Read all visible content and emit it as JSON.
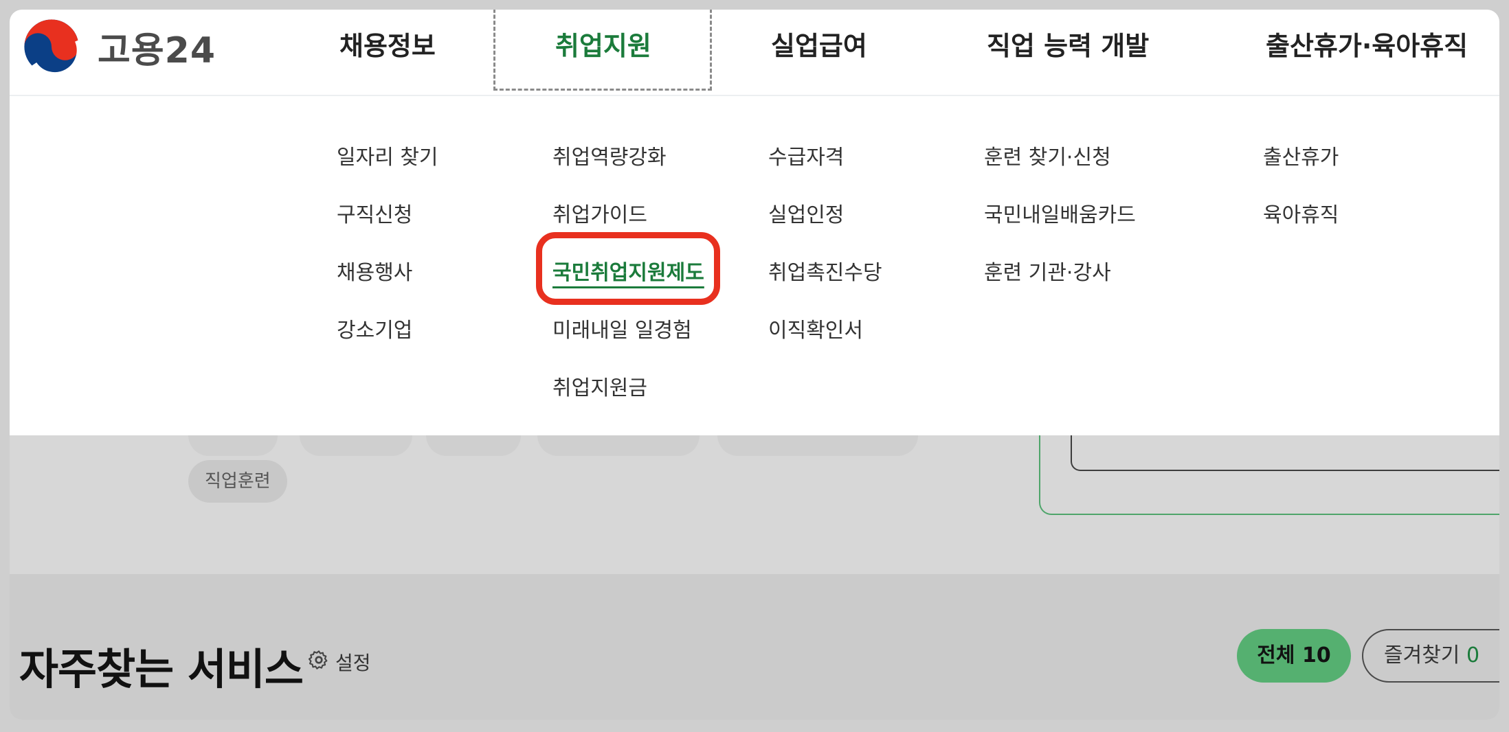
{
  "brand": {
    "name": "고용24"
  },
  "gnb": [
    {
      "label": "채용정보"
    },
    {
      "label": "취업지원",
      "active": true
    },
    {
      "label": "실업급여"
    },
    {
      "label": "직업 능력 개발"
    },
    {
      "label": "출산휴가·육아휴직"
    }
  ],
  "menu": {
    "col1": [
      "일자리 찾기",
      "구직신청",
      "채용행사",
      "강소기업"
    ],
    "col2": [
      "취업역량강화",
      "취업가이드",
      "국민취업지원제도",
      "미래내일 일경험",
      "취업지원금"
    ],
    "col3": [
      "수급자격",
      "실업인정",
      "취업촉진수당",
      "이직확인서"
    ],
    "col4": [
      "훈련 찾기·신청",
      "국민내일배움카드",
      "훈련 기관·강사"
    ],
    "col5": [
      "출산휴가",
      "육아휴직"
    ],
    "highlighted_item": "국민취업지원제도"
  },
  "background": {
    "chip_label": "직업훈련",
    "section_title": "자주찾는 서비스",
    "settings_label": "설정",
    "all_label": "전체 10",
    "favorites_label": "즐겨찾기",
    "favorites_count": "0"
  },
  "colors": {
    "accent_green": "#1b7b3b",
    "highlight_red": "#e8301f",
    "pill_green": "#55b070"
  }
}
